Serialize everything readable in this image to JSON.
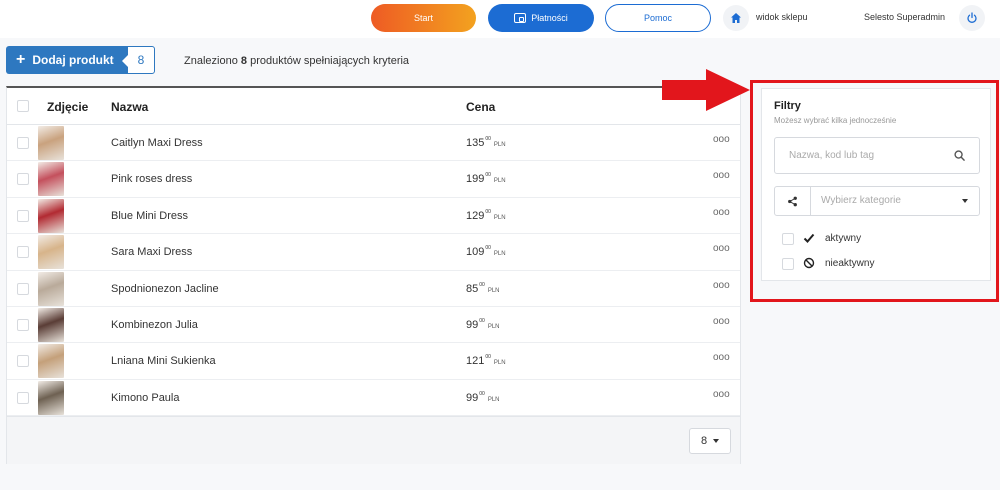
{
  "topbar": {
    "start_label": "Start",
    "payments_label": "Płatności",
    "help_label": "Pomoc",
    "shop_view_label": "widok sklepu",
    "user_name": "Selesto Superadmin"
  },
  "toolbar": {
    "add_product_label": "Dodaj produkt",
    "count": "8",
    "found_prefix": "Znaleziono",
    "found_count": "8",
    "found_suffix": "produktów spełniających kryteria"
  },
  "table": {
    "headers": {
      "photo": "Zdjęcie",
      "name": "Nazwa",
      "price": "Cena"
    },
    "rows": [
      {
        "name": "Caitlyn Maxi Dress",
        "price": "135",
        "cents": "00",
        "currency": "PLN",
        "photo_color": "#c9a27e"
      },
      {
        "name": "Pink roses dress",
        "price": "199",
        "cents": "00",
        "currency": "PLN",
        "photo_color": "#c4505d"
      },
      {
        "name": "Blue Mini Dress",
        "price": "129",
        "cents": "00",
        "currency": "PLN",
        "photo_color": "#b22a32"
      },
      {
        "name": "Sara Maxi Dress",
        "price": "109",
        "cents": "00",
        "currency": "PLN",
        "photo_color": "#d7b48a"
      },
      {
        "name": "Spodnionezon Jacline",
        "price": "85",
        "cents": "00",
        "currency": "PLN",
        "photo_color": "#b9aa9a"
      },
      {
        "name": "Kombinezon Julia",
        "price": "99",
        "cents": "00",
        "currency": "PLN",
        "photo_color": "#5a3d36"
      },
      {
        "name": "Lniana Mini Sukienka",
        "price": "121",
        "cents": "00",
        "currency": "PLN",
        "photo_color": "#c4a07a"
      },
      {
        "name": "Kimono Paula",
        "price": "99",
        "cents": "00",
        "currency": "PLN",
        "photo_color": "#6e6152"
      }
    ],
    "row_menu": "ooo",
    "per_page": "8"
  },
  "filters": {
    "title": "Filtry",
    "subtitle": "Możesz wybrać kilka jednocześnie",
    "search_placeholder": "Nazwa, kod lub tag",
    "category_placeholder": "Wybierz kategorie",
    "options": [
      {
        "label": "aktywny",
        "icon": "check-icon"
      },
      {
        "label": "nieaktywny",
        "icon": "ban-icon"
      }
    ]
  },
  "colors": {
    "accent": "#1c6cd3",
    "add_button": "#2e78c0",
    "start_gradient_from": "#ee5b24",
    "start_gradient_to": "#f3a21f",
    "annotation": "#e2161c"
  }
}
